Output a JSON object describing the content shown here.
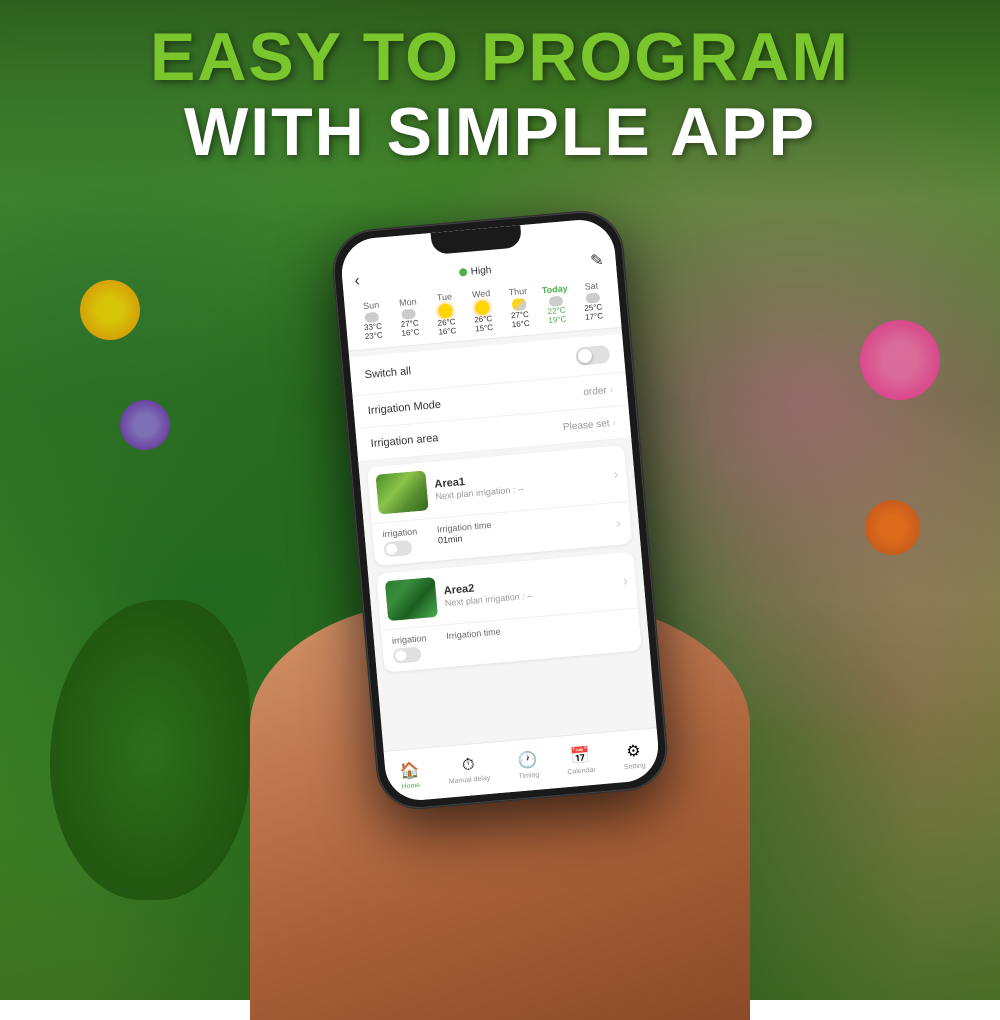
{
  "page": {
    "title_line1": "EASY TO PROGRAM",
    "title_line2": "WITH SIMPLE APP"
  },
  "phone": {
    "header": {
      "back_icon": "‹",
      "signal_label": "High",
      "edit_icon": "✎"
    },
    "weather": {
      "days": [
        {
          "name": "Sun",
          "icon": "cloud",
          "high": "33°C",
          "low": "23°C",
          "today": false
        },
        {
          "name": "Mon",
          "icon": "cloud",
          "high": "27°C",
          "low": "16°C",
          "today": false
        },
        {
          "name": "Tue",
          "icon": "sun",
          "high": "26°C",
          "low": "16°C",
          "today": false
        },
        {
          "name": "Wed",
          "icon": "sun",
          "high": "26°C",
          "low": "15°C",
          "today": false
        },
        {
          "name": "Thur",
          "icon": "part",
          "high": "27°C",
          "low": "16°C",
          "today": false
        },
        {
          "name": "Today",
          "icon": "cloud",
          "high": "22°C",
          "low": "19°C",
          "today": true
        },
        {
          "name": "Sat",
          "icon": "cloud",
          "high": "25°C",
          "low": "17°C",
          "today": false
        }
      ]
    },
    "settings": {
      "switch_all_label": "Switch all",
      "irrigation_mode_label": "Irrigation Mode",
      "irrigation_mode_value": "order",
      "irrigation_area_label": "Irrigation area",
      "irrigation_area_value": "Please set"
    },
    "areas": [
      {
        "name": "Area1",
        "next_irrigation": "Next plan irrigation : --",
        "irrigation_label": "irrigation",
        "irrigation_time_label": "Irrigation time",
        "irrigation_time_value": "01min",
        "thumb": "1"
      },
      {
        "name": "Area2",
        "next_irrigation": "Next plan irrigation : --",
        "irrigation_label": "irrigation",
        "irrigation_time_label": "Irrigation time",
        "irrigation_time_value": "",
        "thumb": "2"
      }
    ],
    "bottom_nav": [
      {
        "icon": "🏠",
        "label": "Home",
        "active": true
      },
      {
        "icon": "⏱",
        "label": "Manual delay",
        "active": false
      },
      {
        "icon": "🕐",
        "label": "Timing",
        "active": false
      },
      {
        "icon": "📅",
        "label": "Calendar",
        "active": false
      },
      {
        "icon": "⚙",
        "label": "Setting",
        "active": false
      }
    ]
  }
}
